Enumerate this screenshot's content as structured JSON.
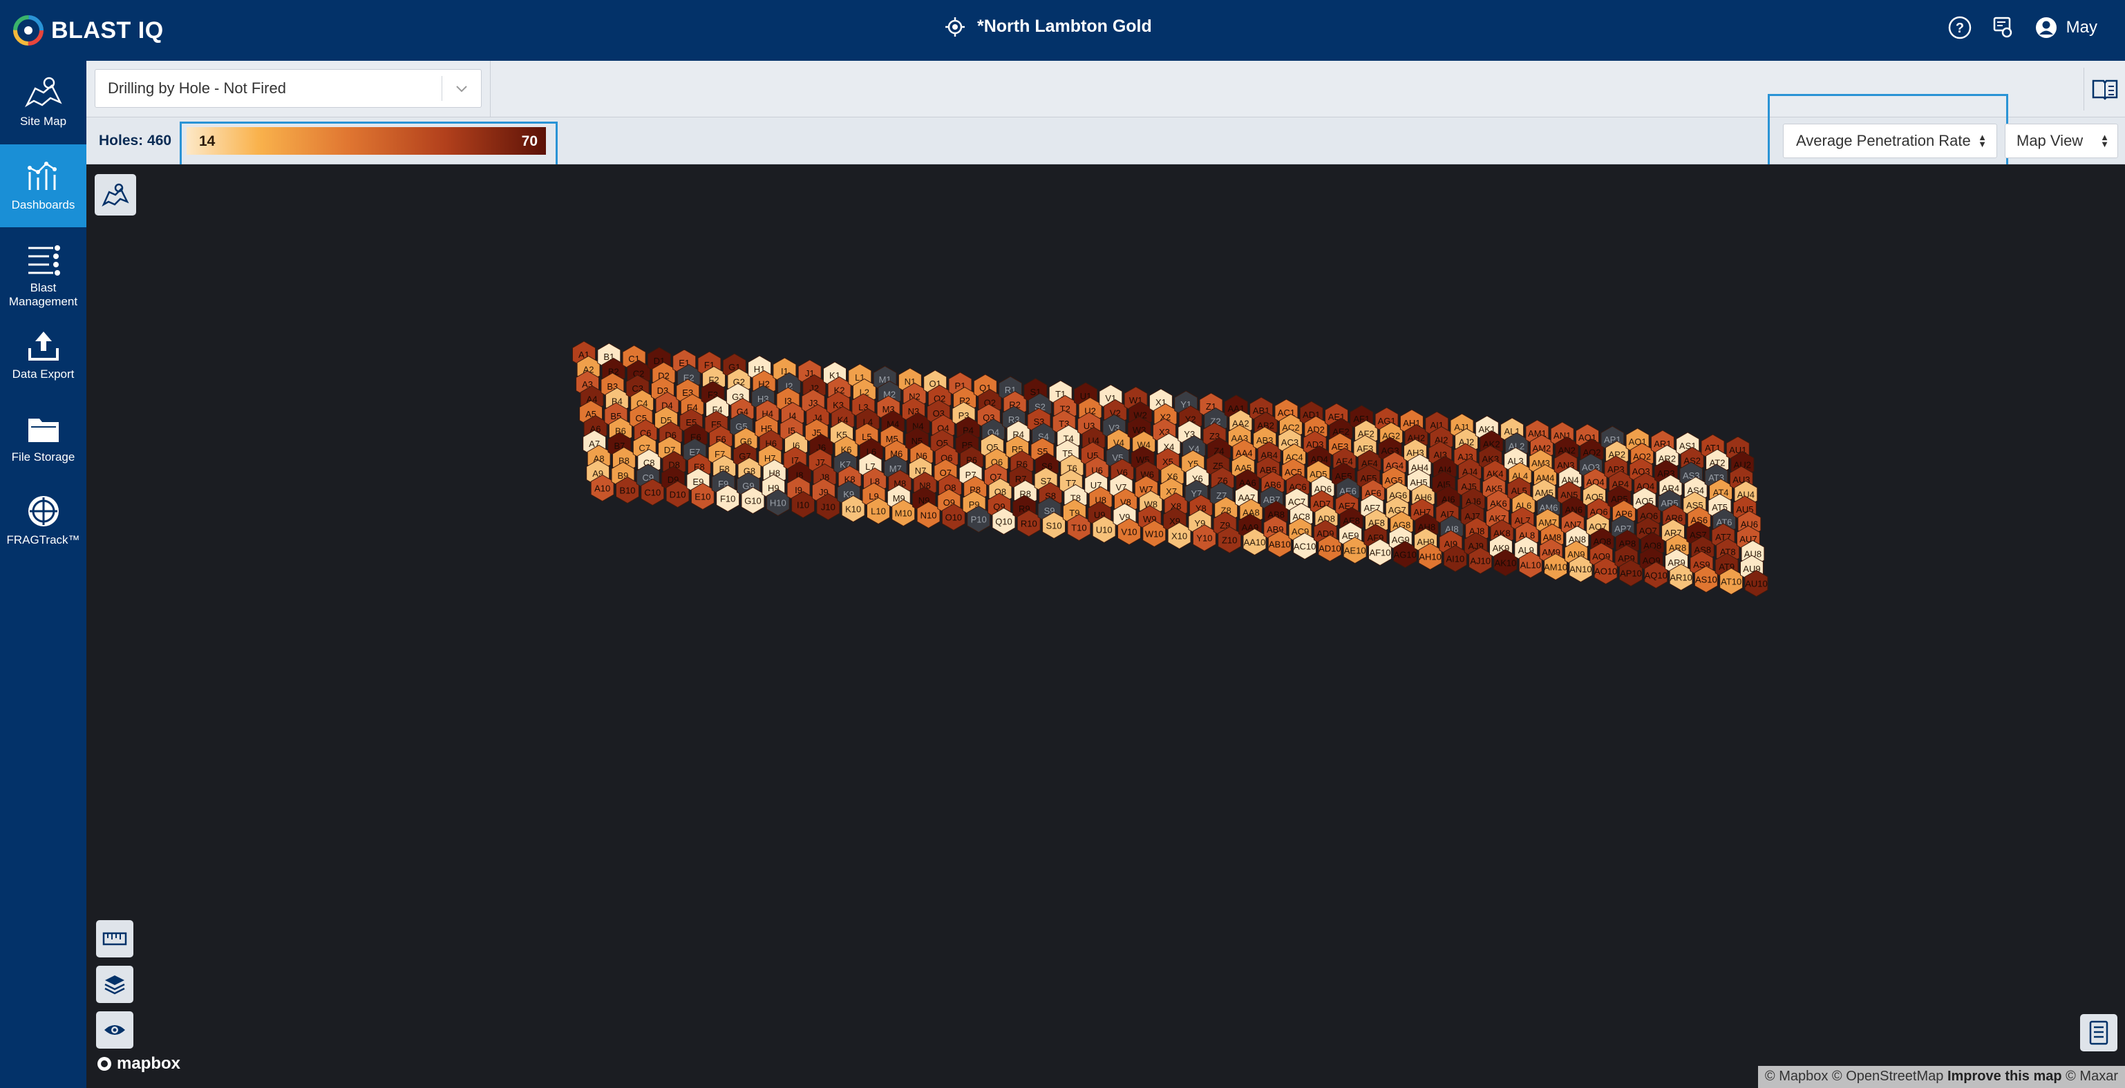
{
  "app": {
    "name": "BLAST IQ",
    "site_title": "*North Lambton Gold",
    "user": "May"
  },
  "colors": {
    "header": "#033269",
    "accent": "#2a93d5",
    "active_nav": "#1a8fd6",
    "map_bg": "#1b1d22",
    "no_data": "#3a3d44"
  },
  "sidebar": {
    "items": [
      {
        "label": "Site Map",
        "icon": "map-icon"
      },
      {
        "label": "Dashboards",
        "icon": "chart-icon",
        "active": true
      },
      {
        "label": "Blast Management",
        "icon": "list-icon"
      },
      {
        "label": "Data Export",
        "icon": "upload-icon"
      },
      {
        "label": "File Storage",
        "icon": "folder-icon"
      },
      {
        "label": "FRAGTrack™",
        "icon": "fragtrack-icon"
      }
    ]
  },
  "toolbar": {
    "view_select": "Drilling by Hole - Not Fired",
    "holes_label": "Holes: 460",
    "legend_min": "14",
    "legend_max": "70",
    "metric_select": "Average Penetration Rate",
    "mapview_select": "Map View"
  },
  "map": {
    "attribution_1": "© Mapbox © OpenStreetMap",
    "attribution_2": "Improve this map",
    "attribution_3": "© Maxar",
    "mapbox_label": "mapbox",
    "hole_pattern": {
      "description_rows": [
        "A",
        "B",
        "C",
        "D",
        "E",
        "F",
        "G",
        "H",
        "I",
        "J",
        "K",
        "L",
        "M",
        "N",
        "O",
        "P",
        "Q",
        "R",
        "S",
        "T",
        "U",
        "V",
        "W",
        "X",
        "Y",
        "Z",
        "AA",
        "AB",
        "AC",
        "AD",
        "AE",
        "AF",
        "AG",
        "AH",
        "AI",
        "AJ",
        "AK",
        "AL",
        "AM",
        "AN",
        "AO",
        "AP",
        "AQ",
        "AR",
        "AS",
        "AT",
        "AU"
      ],
      "holes_per_row": 10
    }
  }
}
